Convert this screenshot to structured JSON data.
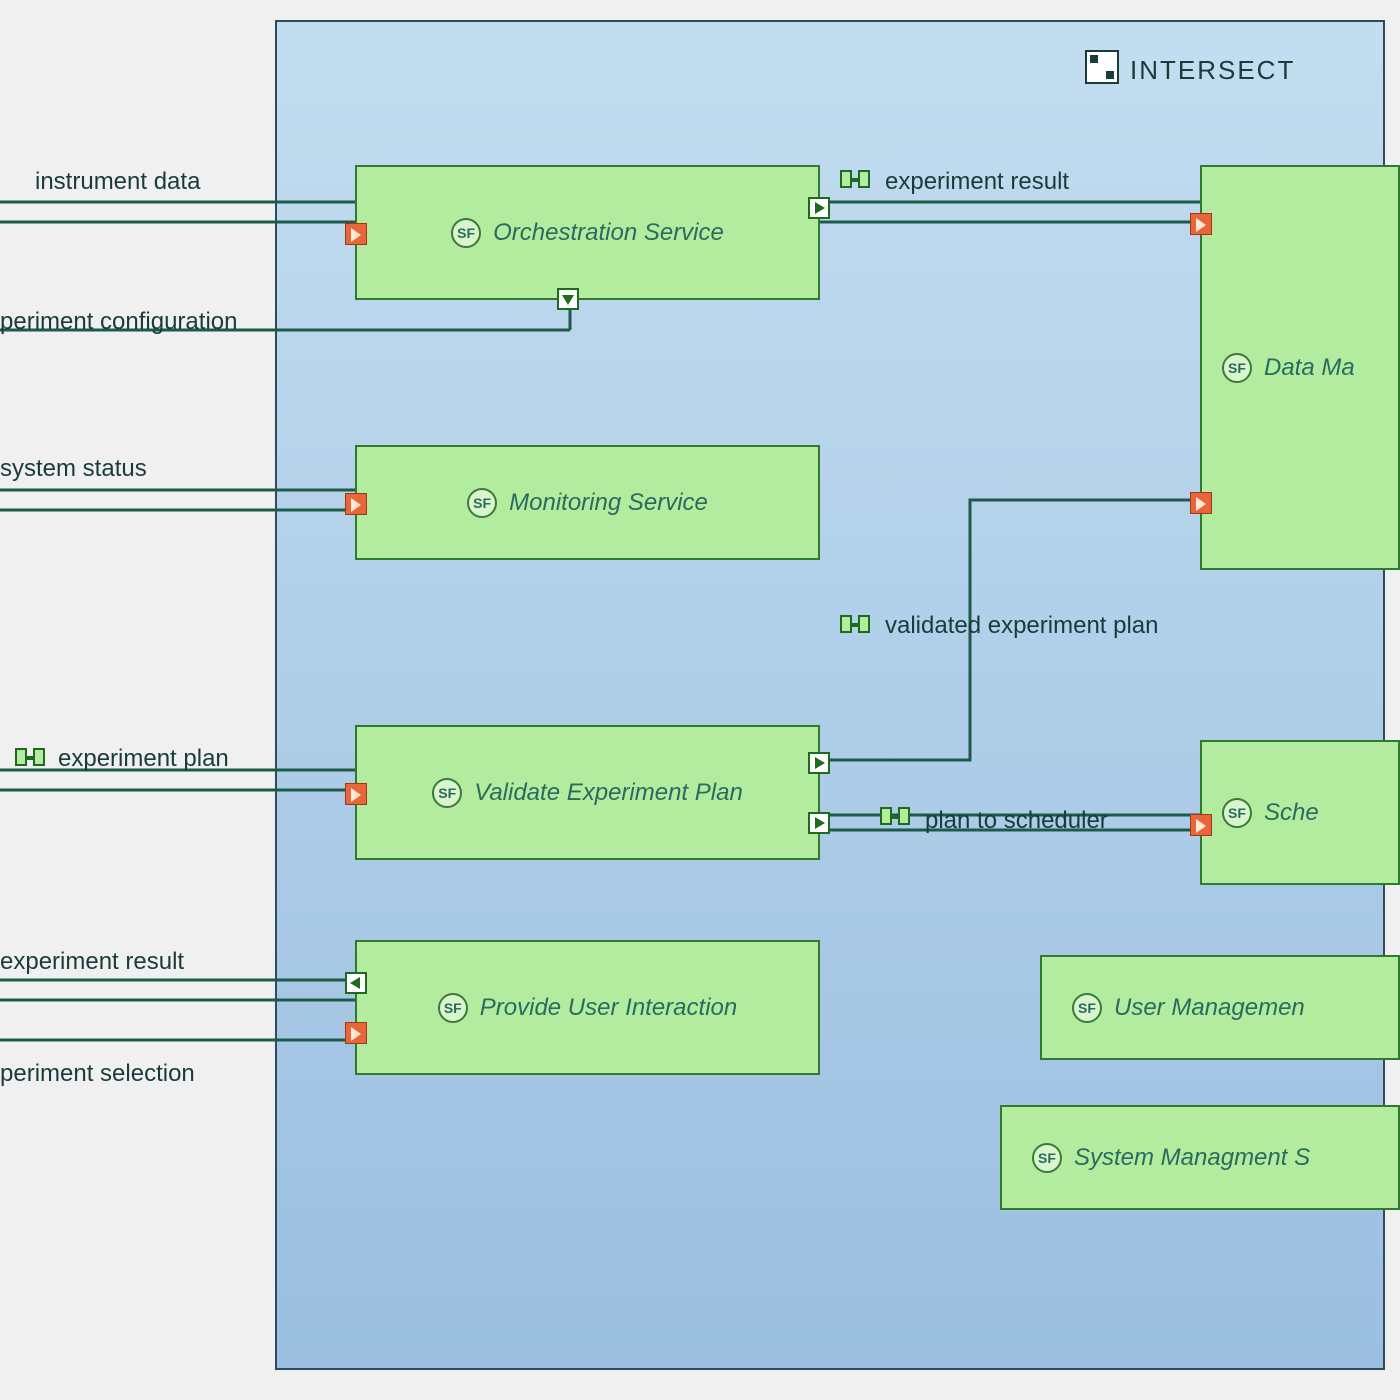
{
  "container": {
    "title": "INTERSECT"
  },
  "services": {
    "orchestration": "Orchestration Service",
    "monitoring": "Monitoring Service",
    "validate": "Validate Experiment Plan",
    "provide_ui": "Provide User Interaction",
    "data_ma": "Data Ma",
    "sche": "Sche",
    "user_mgmt": "User Managemen",
    "sys_mgmt": "System Managment S"
  },
  "external_labels": {
    "instrument_data": "instrument data",
    "periment_configuration": "periment configuration",
    "system_status": "system status",
    "experiment_plan": "experiment plan",
    "experiment_result_left": "experiment result",
    "periment_selection": "periment selection"
  },
  "connection_labels": {
    "experiment_result": "experiment result",
    "validated_plan": "validated experiment plan",
    "plan_to_scheduler": "plan to scheduler"
  },
  "sf_badge": "SF"
}
